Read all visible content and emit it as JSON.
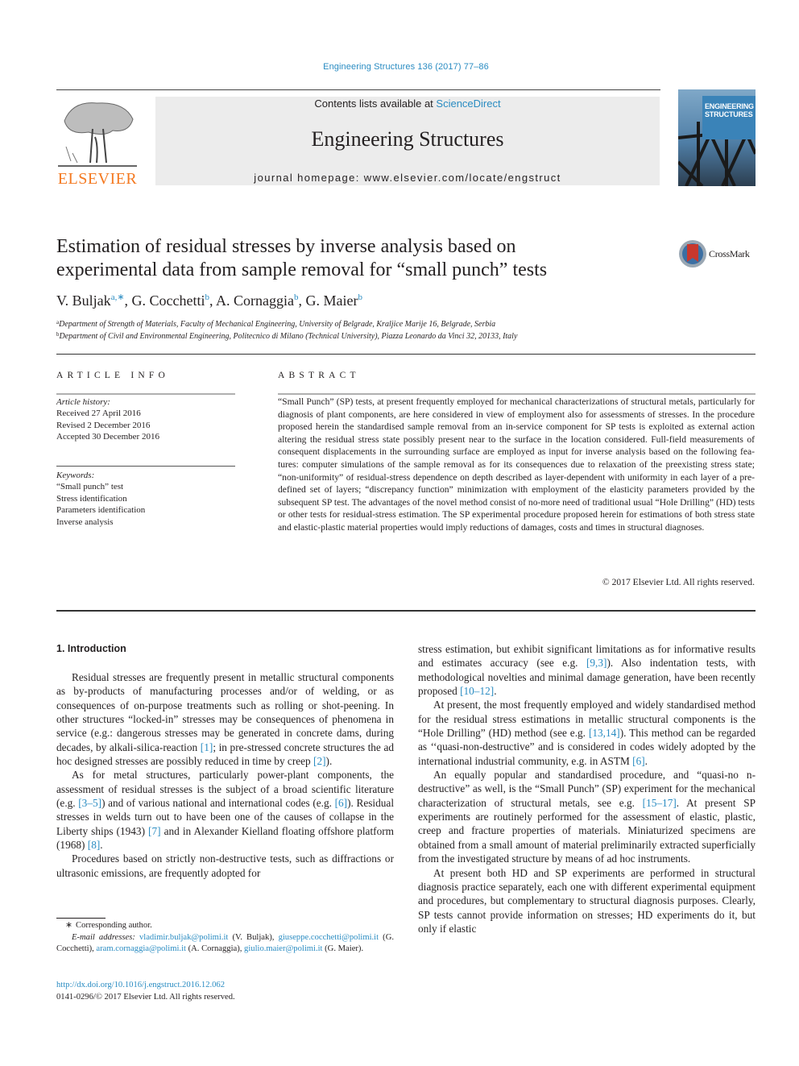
{
  "header": {
    "journal_ref": "Engineering Structures 136 (2017) 77–86",
    "contents_prefix": "Contents lists available at ",
    "contents_link": "ScienceDirect",
    "journal_name": "Engineering Structures",
    "homepage": "journal homepage: www.elsevier.com/locate/engstruct",
    "publisher_logo_text": "ELSEVIER",
    "cover_title_line1": "ENGINEERING",
    "cover_title_line2": "STRUCTURES",
    "crossmark_label": "CrossMark",
    "colors": {
      "link": "#2a8cc2",
      "elsevier_orange": "#f47920",
      "masthead_bg": "#ececec"
    }
  },
  "article": {
    "title_line1": "Estimation of residual stresses by inverse analysis based on",
    "title_line2": "experimental data from sample removal for “small punch” tests",
    "authors": [
      {
        "name": "V. Buljak",
        "sup": "a,∗",
        "sep": ", "
      },
      {
        "name": "G. Cocchetti",
        "sup": "b",
        "sep": ", "
      },
      {
        "name": "A. Cornaggia",
        "sup": "b",
        "sep": ", "
      },
      {
        "name": "G. Maier",
        "sup": "b",
        "sep": ""
      }
    ],
    "affiliations": [
      {
        "mark": "a",
        "text": "Department of Strength of Materials, Faculty of Mechanical Engineering, University of Belgrade, Kraljice Marije 16, Belgrade, Serbia"
      },
      {
        "mark": "b",
        "text": "Department of Civil and Environmental Engineering, Politecnico di Milano (Technical University), Piazza Leonardo da Vinci 32, 20133, Italy"
      }
    ]
  },
  "article_info": {
    "heading": "ARTICLE INFO",
    "history_label": "Article history:",
    "history": [
      "Received 27 April 2016",
      "Revised 2 December 2016",
      "Accepted 30 December 2016"
    ],
    "keywords_label": "Keywords:",
    "keywords": [
      "“Small punch” test",
      "Stress identification",
      "Parameters identification",
      "Inverse analysis"
    ]
  },
  "abstract": {
    "heading": "ABSTRACT",
    "text": "“Small Punch” (SP) tests, at present frequently employed for mechanical characterizations of structural metals, particularly for diagnosis of plant components, are here considered in view of employment also for assessments of stresses. In the procedure proposed herein the standardised sample removal from an in-service component for SP tests is exploited as external action altering the residual stress state possibly present near to the surface in the location considered. Full-field measurements of consequent displace­ments in the surrounding surface are employed as input for inverse analysis based on the following fea­tures: computer simulations of the sample removal as for its consequences due to relaxation of the pre­existing stress state; “non-uniformity” of residual-stress dependence on depth described as layer-dependent with uniformity in each layer of a pre-defined set of layers; “discrepancy function” minimiza­tion with employment of the elasticity parameters provided by the subsequent SP test. The advantages of the novel method consist of no-more need of traditional usual “Hole Drilling” (HD) tests or other tests for residual-stress estimation. The SP experimental procedure proposed herein for estimations of both stress state and elastic-plastic material properties would imply reductions of damages, costs and times in struc­tural diagnoses.",
    "copyright": "© 2017 Elsevier Ltd. All rights reserved."
  },
  "intro": {
    "heading": "1. Introduction",
    "left_paragraphs": [
      [
        {
          "t": "Residual stresses are frequently present in metallic structural components as by-products of manufacturing processes and/or of welding, or as consequences of on-purpose treatments such as roll­ing or shot-peening. In other structures “locked-in” stresses may be consequences of phenomena in service (e.g.: dangerous stresses may be generated in concrete dams, during decades, by alkali-silica-reaction "
        },
        {
          "ref": "[1]"
        },
        {
          "t": "; in pre-stressed concrete structures the ad hoc designed stresses are possibly reduced in time by creep "
        },
        {
          "ref": "[2]"
        },
        {
          "t": ")."
        }
      ],
      [
        {
          "t": "As for metal structures, particularly power-plant components, the assessment of residual stresses is the subject of a broad scien­tific literature (e.g. "
        },
        {
          "ref": "[3–5]"
        },
        {
          "t": ") and of various national and international codes (e.g. "
        },
        {
          "ref": "[6]"
        },
        {
          "t": "). Residual stresses in welds turn out to have been one of the causes of collapse in the Liberty ships (1943) "
        },
        {
          "ref": "[7]"
        },
        {
          "t": " and in Alexander Kielland floating offshore platform (1968) "
        },
        {
          "ref": "[8]"
        },
        {
          "t": "."
        }
      ],
      [
        {
          "t": "Procedures based on strictly non-destructive tests, such as diffractions or ultrasonic emissions, are frequently adopted for"
        }
      ]
    ],
    "right_paragraphs": [
      [
        {
          "t": "stress estimation, but exhibit significant limitations as for informa­tive results and estimates accuracy (see e.g. "
        },
        {
          "ref": "[9,3]"
        },
        {
          "t": "). Also indentation tests, with methodological novelties and minimal damage genera­tion, have been recently proposed "
        },
        {
          "ref": "[10–12]"
        },
        {
          "t": "."
        }
      ],
      [
        {
          "t": "At present, the most frequently employed and widely standard­ised method for the residual stress estimations in metallic struc­tural components is the “Hole Drilling” (HD) method (see e.g. "
        },
        {
          "ref": "[13,14]"
        },
        {
          "t": "). This method can be regarded as ‘‘quasi-non-destructive” and is considered in codes widely adopted by the international industrial community, e.g. in ASTM "
        },
        {
          "ref": "[6]"
        },
        {
          "t": "."
        }
      ],
      [
        {
          "t": "An equally popular and standardised procedure, and “quasi-no n-destructive” as well, is the “Small Punch” (SP) experiment for the mechanical characterization of structural metals, see e.g. "
        },
        {
          "ref": "[15–17]"
        },
        {
          "t": ". At present SP experiments are routinely performed for the assessment of elastic, plastic, creep and fracture properties of materials. Miniaturized specimens are obtained from a small amount of material preliminarily extracted superficially from the investigated structure by means of ad hoc instruments."
        }
      ],
      [
        {
          "t": "At present both HD and SP experiments are performed in struc­tural diagnosis practice separately, each one with different exper­imental equipment and procedures, but complementary to structural diagnosis purposes. Clearly, SP tests cannot provide information on stresses; HD experiments do it, but only if elastic"
        }
      ]
    ]
  },
  "footnotes": {
    "star": "∗",
    "corresponding": "Corresponding author.",
    "email_label": "E-mail addresses:",
    "emails": [
      {
        "email": "vladimir.buljak@polimi.it",
        "who": " (V. Buljak), "
      },
      {
        "email": "giuseppe.cocchetti@po­limi.it",
        "who": " (G. Cocchetti), "
      },
      {
        "email": "aram.cornaggia@polimi.it",
        "who": " (A. Cornaggia), "
      },
      {
        "email": "giulio.maier@polimi.it",
        "who": " (G. Maier)."
      }
    ],
    "doi": "http://dx.doi.org/10.1016/j.engstruct.2016.12.062",
    "issn": "0141-0296/© 2017 Elsevier Ltd. All rights reserved."
  }
}
